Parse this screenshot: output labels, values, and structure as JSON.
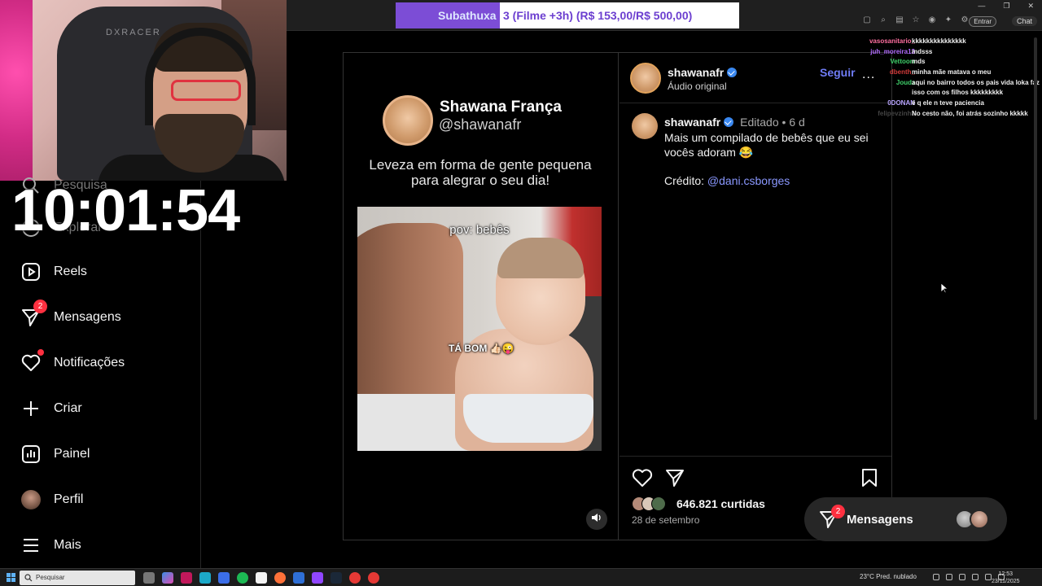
{
  "stream": {
    "clock": "10:01:54",
    "subathon_left": "Subathuxa",
    "subathon_right": "3 (Filme +3h) (R$ 153,00/R$ 500,00)",
    "webcam_chair_logo": "DXRACER"
  },
  "browser": {
    "enter_label": "Entrar",
    "chat_label": "Chat"
  },
  "sidebar": {
    "items": [
      {
        "label": "Pesquisa",
        "icon": "search-icon"
      },
      {
        "label": "Explorar",
        "icon": "compass-icon"
      },
      {
        "label": "Reels",
        "icon": "reels-icon"
      },
      {
        "label": "Mensagens",
        "icon": "messenger-icon",
        "badge": "2"
      },
      {
        "label": "Notificações",
        "icon": "heart-icon"
      },
      {
        "label": "Criar",
        "icon": "plus-icon"
      },
      {
        "label": "Painel",
        "icon": "dashboard-icon"
      },
      {
        "label": "Perfil",
        "icon": "profile-avatar"
      },
      {
        "label": "Mais",
        "icon": "menu-icon"
      }
    ]
  },
  "post": {
    "media": {
      "name": "Shawana França",
      "handle": "@shawanafr",
      "tagline": "Leveza em forma de gente pequena para alegrar o seu dia!",
      "caption_top": "pov: bebês",
      "caption_mid": "TÁ BOM 👍🏻😜"
    },
    "header": {
      "username": "shawanafr",
      "audio": "Áudio original",
      "follow": "Seguir",
      "more": "..."
    },
    "caption": {
      "username": "shawanafr",
      "edited": "Editado",
      "sep": "•",
      "age": "6 d",
      "text": "Mais um compilado de bebês que eu sei vocês adoram 😂",
      "credit_label": "Crédito:",
      "credit_link": "@dani.csborges"
    },
    "likes": "646.821 curtidas",
    "date": "28 de setembro"
  },
  "messages_pill": {
    "label": "Mensagens",
    "badge": "2"
  },
  "chat": [
    {
      "user": "vasosanitario_",
      "color": "#ff6fa0",
      "msg": "kkkkkkkkkkkkkkk"
    },
    {
      "user": "juh_moreira13",
      "color": "#b26bff",
      "msg": "mdsss"
    },
    {
      "user": "Vettoorr",
      "color": "#3fd06a",
      "msg": "mds"
    },
    {
      "user": "dbenth_",
      "color": "#d23a3a",
      "msg": "minha mãe matava o meu"
    },
    {
      "user": "Joudz",
      "color": "#3fd06a",
      "msg": "aqui no bairro todos os pais vida loka faz"
    },
    {
      "user": "",
      "color": "#ffffff",
      "msg": "isso com os filhos kkkkkkkkk"
    },
    {
      "user": "0DONAN",
      "color": "#b9a5ff",
      "msg": "é q ele n teve paciencia"
    },
    {
      "user": "felipevzinha",
      "color": "#444444",
      "msg": "No cesto não, foi atrás sozinho kkkkk"
    }
  ],
  "taskbar": {
    "search_placeholder": "Pesquisar",
    "weather": "23°C  Pred. nublado",
    "time": "12:53",
    "date": "23/11/2025"
  },
  "colors": {
    "accent_link": "#8a98ff",
    "follow": "#6f7cf5",
    "badge": "#ff3040",
    "subathon_purple": "#7c4dd6"
  }
}
